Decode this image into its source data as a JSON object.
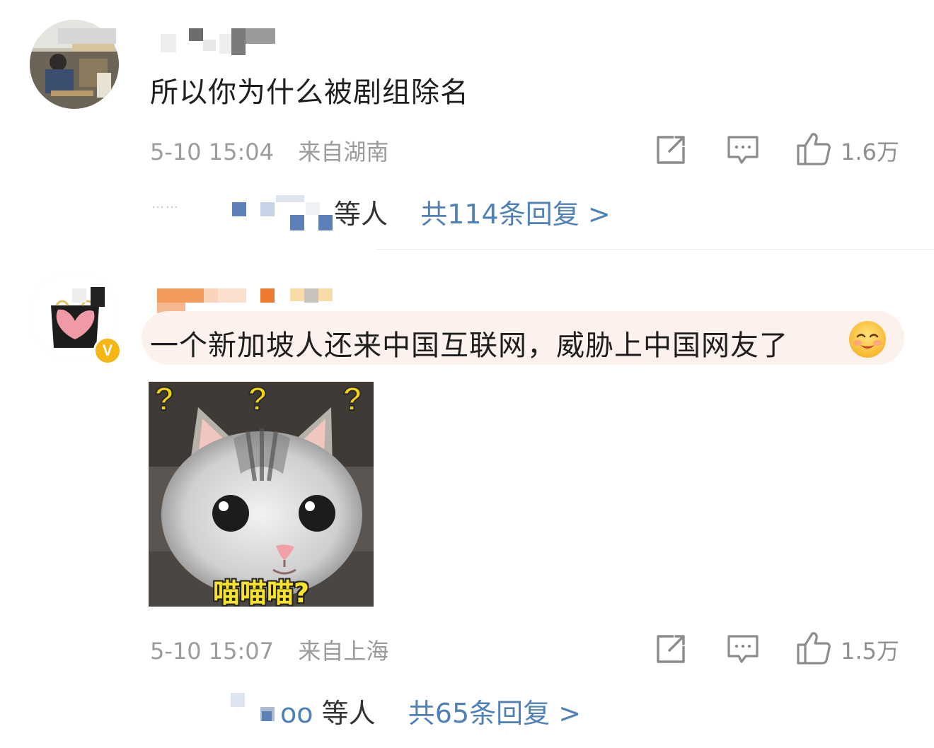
{
  "comments": [
    {
      "text": "所以你为什么被剧组除名",
      "time": "5-10 15:04",
      "location": "来自湖南",
      "likes": "1.6万",
      "reply_people_suffix": "等人",
      "reply_total": "共114条回复 >",
      "dots": "……"
    },
    {
      "text": "一个新加坡人还来中国互联网，威胁上中国网友了",
      "emoji": "smiling-face",
      "sticker_caption": "喵喵喵?",
      "time": "5-10 15:07",
      "location": "来自上海",
      "likes": "1.5万",
      "reply_people_prefix": "oo",
      "reply_people_suffix": "等人",
      "reply_total": "共65条回复 >",
      "badge": "V"
    }
  ],
  "icons": [
    "share-icon",
    "comment-icon",
    "like-icon"
  ],
  "colors": {
    "link": "#4f80b8",
    "meta": "#9b9b9b",
    "highlight": "#fdf1ee",
    "badge": "#f5b512"
  }
}
